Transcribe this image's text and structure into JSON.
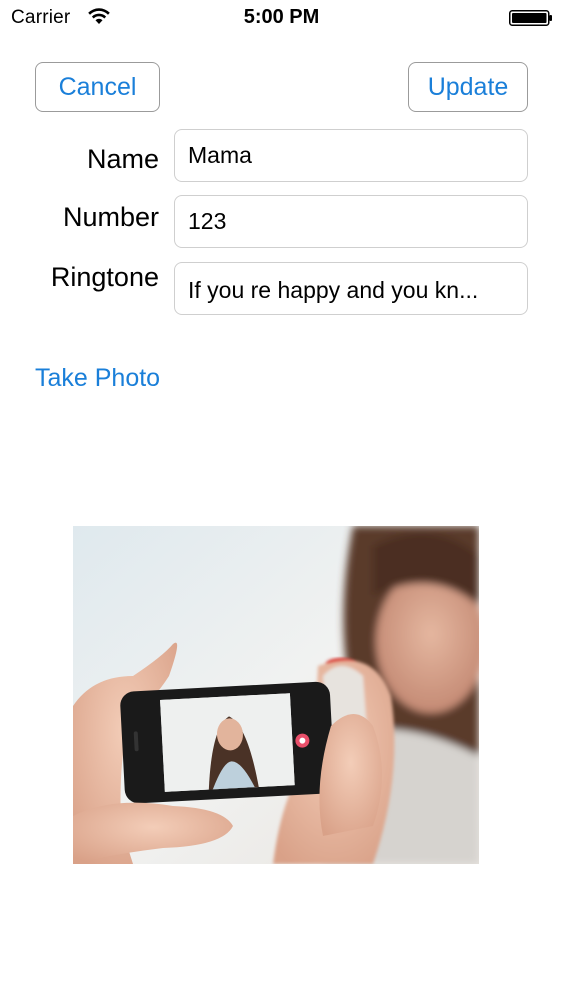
{
  "status_bar": {
    "carrier": "Carrier",
    "time": "5:00 PM",
    "icons": [
      "wifi-icon",
      "battery-icon"
    ]
  },
  "toolbar": {
    "cancel_label": "Cancel",
    "update_label": "Update"
  },
  "form": {
    "name": {
      "label": "Name",
      "value": "Mama"
    },
    "number": {
      "label": "Number",
      "value": "123"
    },
    "ringtone": {
      "label": "Ringtone",
      "value": "If you re happy and you kn..."
    }
  },
  "take_photo_label": "Take Photo",
  "colors": {
    "accent": "#1a7fd9",
    "field_border": "#cfcfcf",
    "button_border": "#9b9b9b"
  }
}
